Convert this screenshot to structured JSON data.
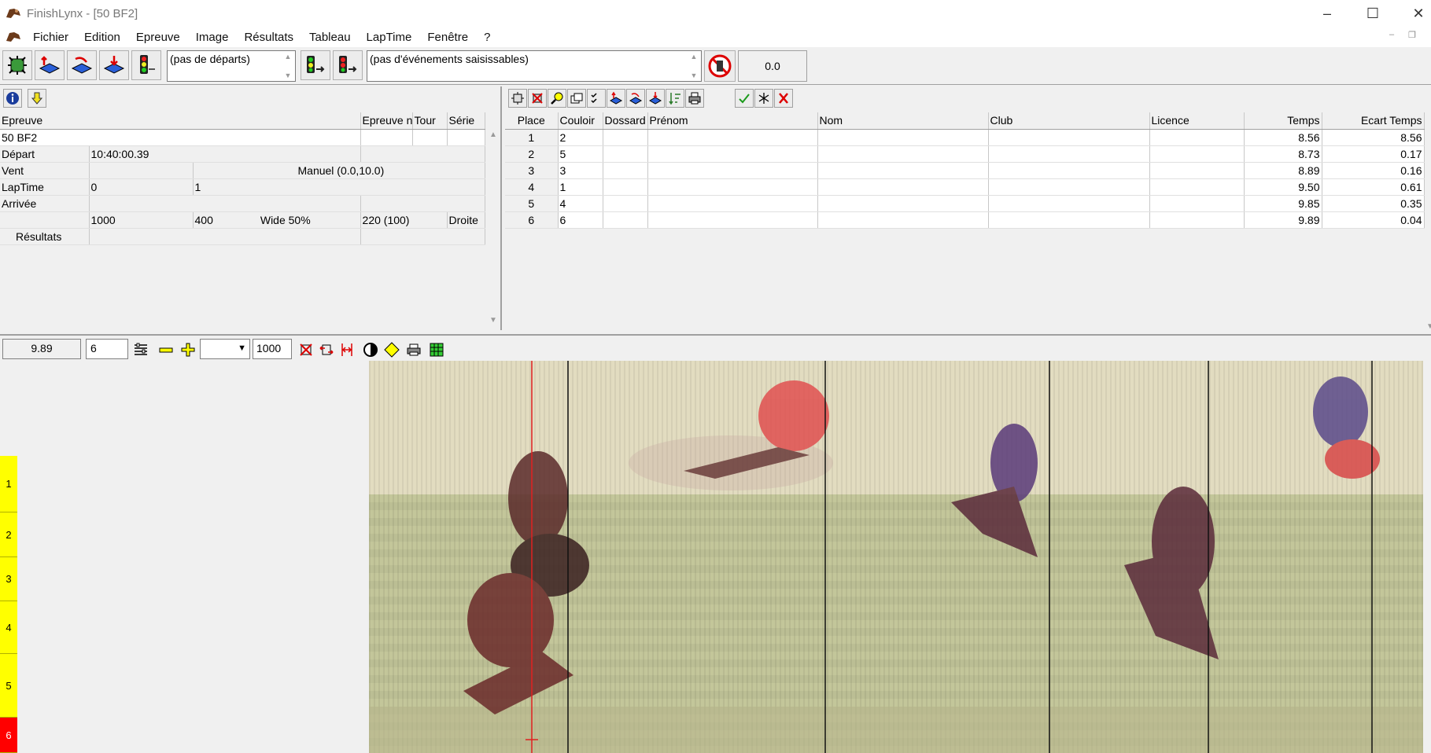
{
  "window": {
    "title": "FinishLynx - [50 BF2]"
  },
  "menu": [
    "Fichier",
    "Edition",
    "Epreuve",
    "Image",
    "Résultats",
    "Tableau",
    "LapTime",
    "Fenêtre",
    "?"
  ],
  "toolbar": {
    "starts_combo": "(pas de départs)",
    "events_combo": "(pas d'événements saisissables)",
    "time_value": "0.0"
  },
  "event_panel": {
    "headers": [
      "Epreuve",
      "Epreuve n",
      "Tour",
      "Série"
    ],
    "event_name": "50 BF2",
    "rows": [
      {
        "label": "Départ",
        "c1": "10:40:00.39",
        "c2": "",
        "c3": ""
      },
      {
        "label": "Vent",
        "c1": "",
        "c2": "",
        "c3": "Manuel (0.0,10.0)"
      },
      {
        "label": "LapTime",
        "c1": "0",
        "c2": "1",
        "c3": ""
      },
      {
        "label": "Arrivée",
        "c1": "",
        "c2": "",
        "c3": ""
      }
    ],
    "settings_row": [
      "1000",
      "400",
      "Wide 50%",
      "220  (100)",
      "Droite"
    ],
    "results_label": "Résultats"
  },
  "results": {
    "headers": [
      "Place",
      "Couloir",
      "Dossard",
      "Prénom",
      "Nom",
      "Club",
      "Licence",
      "Temps",
      "Ecart Temps"
    ],
    "rows": [
      {
        "place": "1",
        "couloir": "2",
        "dossard": "",
        "prenom": "",
        "nom": "",
        "club": "",
        "licence": "",
        "temps": "8.56",
        "ecart": "8.56"
      },
      {
        "place": "2",
        "couloir": "5",
        "dossard": "",
        "prenom": "",
        "nom": "",
        "club": "",
        "licence": "",
        "temps": "8.73",
        "ecart": "0.17"
      },
      {
        "place": "3",
        "couloir": "3",
        "dossard": "",
        "prenom": "",
        "nom": "",
        "club": "",
        "licence": "",
        "temps": "8.89",
        "ecart": "0.16"
      },
      {
        "place": "4",
        "couloir": "1",
        "dossard": "",
        "prenom": "",
        "nom": "",
        "club": "",
        "licence": "",
        "temps": "9.50",
        "ecart": "0.61"
      },
      {
        "place": "5",
        "couloir": "4",
        "dossard": "",
        "prenom": "",
        "nom": "",
        "club": "",
        "licence": "",
        "temps": "9.85",
        "ecart": "0.35"
      },
      {
        "place": "6",
        "couloir": "6",
        "dossard": "",
        "prenom": "",
        "nom": "",
        "club": "",
        "licence": "",
        "temps": "9.89",
        "ecart": "0.04"
      }
    ]
  },
  "image_toolbar": {
    "cursor_time": "9.89",
    "place_field": "6",
    "density": "1000"
  },
  "lanes": [
    "1",
    "2",
    "3",
    "4",
    "5",
    "6"
  ],
  "colors": {
    "lane_bg": "#ffff00",
    "lane_active": "#ff0000",
    "cursor_line": "#e02020"
  }
}
